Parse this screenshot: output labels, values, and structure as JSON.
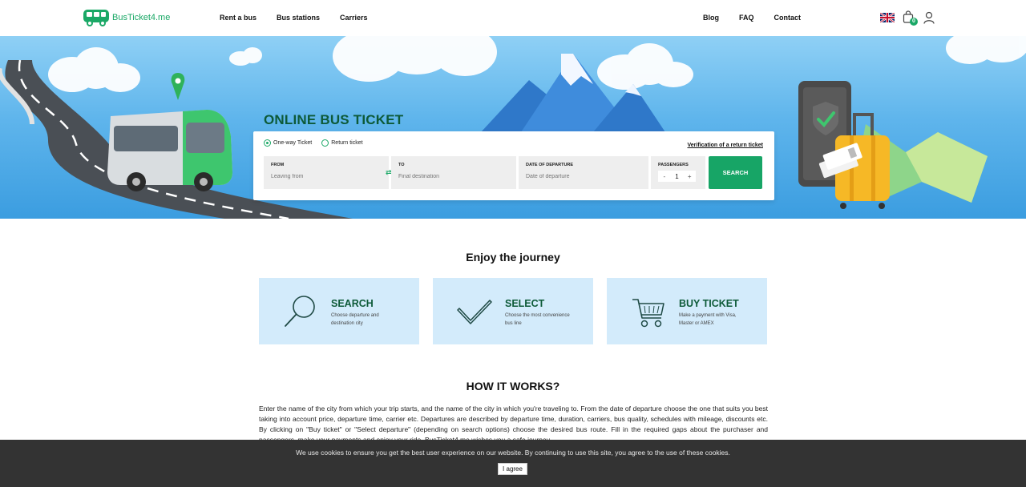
{
  "brand": {
    "name": "BusTicket4.me",
    "color": "#1aa866"
  },
  "nav": {
    "left": [
      "Rent a bus",
      "Bus stations",
      "Carriers"
    ],
    "right": [
      "Blog",
      "FAQ",
      "Contact"
    ]
  },
  "header_icons": {
    "language": "uk-flag-icon",
    "cart_count": "0",
    "user": "user-icon"
  },
  "hero": {
    "title": "ONLINE BUS TICKET",
    "trip_types": [
      "One-way Ticket",
      "Return ticket"
    ],
    "selected_trip_type": "One-way Ticket",
    "verify_link": "Verification of a return ticket",
    "from": {
      "label": "FROM",
      "placeholder": "Leaving from"
    },
    "to": {
      "label": "TO",
      "placeholder": "Final destination"
    },
    "date": {
      "label": "DATE OF DEPARTURE",
      "placeholder": "Date of departure"
    },
    "passengers": {
      "label": "PASSENGERS",
      "value": "1",
      "minus": "-",
      "plus": "+"
    },
    "search_label": "SEARCH"
  },
  "enjoy": {
    "title": "Enjoy the journey",
    "steps": [
      {
        "title": "SEARCH",
        "desc": "Choose departure and destination city",
        "icon": "search-icon"
      },
      {
        "title": "SELECT",
        "desc": "Choose the most convenience bus line",
        "icon": "checkmark-icon"
      },
      {
        "title": "BUY TICKET",
        "desc": "Make a payment with Visa, Master or AMEX",
        "icon": "cart-icon"
      }
    ]
  },
  "how_it_works": {
    "title": "HOW IT WORKS?",
    "text": "Enter the name of the city from which your trip starts, and the name of the city in which you're traveling to. From the date of departure choose the one that suits you best taking into account price, departure time, carrier etc. Departures are described by departure time, duration, carriers, bus quality, schedules with mileage, discounts etc. By clicking on \"Buy ticket\" or \"Select departure\" (depending on search options) choose the desired bus route. Fill in the required gaps about the purchaser and passengers, make your payments and enjoy your ride. BusTicket4.me wishes you a safe journey."
  },
  "cookie": {
    "text": "We use cookies to ensure you get the best user experience on our website. By continuing to use this site, you agree to the use of these cookies.",
    "button": "I agree"
  }
}
